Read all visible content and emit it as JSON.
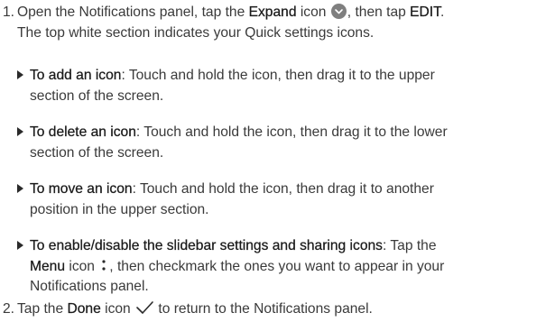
{
  "step1": {
    "number": "1.",
    "line1_a": "Open the Notifications panel, tap the ",
    "line1_b": "Expand",
    "line1_c": " icon ",
    "line1_d": ", then tap ",
    "line1_e": "EDIT",
    "line1_f": ".",
    "line2": "The top white section indicates your Quick settings icons."
  },
  "bullets": [
    {
      "title": "To add an icon",
      "text_line1": ": Touch and hold the icon, then drag it to the upper",
      "text_line2": "section of the screen."
    },
    {
      "title": "To delete an icon",
      "text_line1": ": Touch and hold the icon, then drag it to the lower",
      "text_line2": "section of the screen."
    },
    {
      "title": "To move an icon",
      "text_line1": ": Touch and hold the icon, then drag it to another",
      "text_line2": "position in the upper section."
    },
    {
      "title": "To enable/disable the slidebar settings and sharing icons",
      "text_a": ": Tap the",
      "menu_word": "Menu",
      "text_b": " icon ",
      "text_c": ", then checkmark the ones you want to appear in your",
      "text_line3": "Notifications panel."
    }
  ],
  "step2": {
    "number": "2.",
    "text_a": "Tap the ",
    "done_word": "Done",
    "text_b": " icon ",
    "text_c": " to return to the Notifications panel."
  },
  "icons": {
    "expand": "chevron-down-circle-icon",
    "menu": "vertical-dots-icon",
    "done": "checkmark-icon"
  },
  "colors": {
    "text": "#3a3a3a",
    "bold_text": "#1a1a1a",
    "expand_icon_bg": "#7f7f7f"
  }
}
